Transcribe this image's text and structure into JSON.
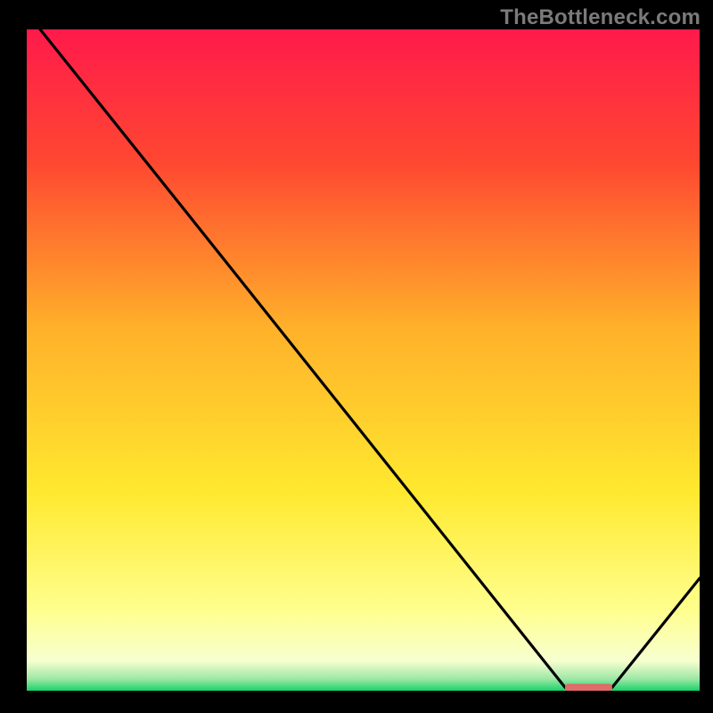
{
  "watermark": "TheBottleneck.com",
  "chart_data": {
    "type": "line",
    "title": "",
    "xlabel": "",
    "ylabel": "",
    "xlim": [
      0,
      100
    ],
    "ylim": [
      0,
      100
    ],
    "gradient_stops": [
      {
        "offset": 0,
        "color": "#ff1a4b"
      },
      {
        "offset": 0.2,
        "color": "#ff4731"
      },
      {
        "offset": 0.45,
        "color": "#ffb02a"
      },
      {
        "offset": 0.7,
        "color": "#ffe92f"
      },
      {
        "offset": 0.88,
        "color": "#ffff8f"
      },
      {
        "offset": 0.955,
        "color": "#f7ffd0"
      },
      {
        "offset": 0.982,
        "color": "#9fe8a6"
      },
      {
        "offset": 1.0,
        "color": "#17d36a"
      }
    ],
    "series": [
      {
        "name": "curve",
        "points": [
          {
            "x": 2.0,
            "y": 100.0
          },
          {
            "x": 24.0,
            "y": 72.0
          },
          {
            "x": 80.0,
            "y": 0.5
          },
          {
            "x": 87.0,
            "y": 0.5
          },
          {
            "x": 100.0,
            "y": 17.0
          }
        ]
      }
    ],
    "marker": {
      "x_start": 80.0,
      "x_end": 87.0,
      "y": 0.5,
      "color": "#e06b6b"
    }
  }
}
